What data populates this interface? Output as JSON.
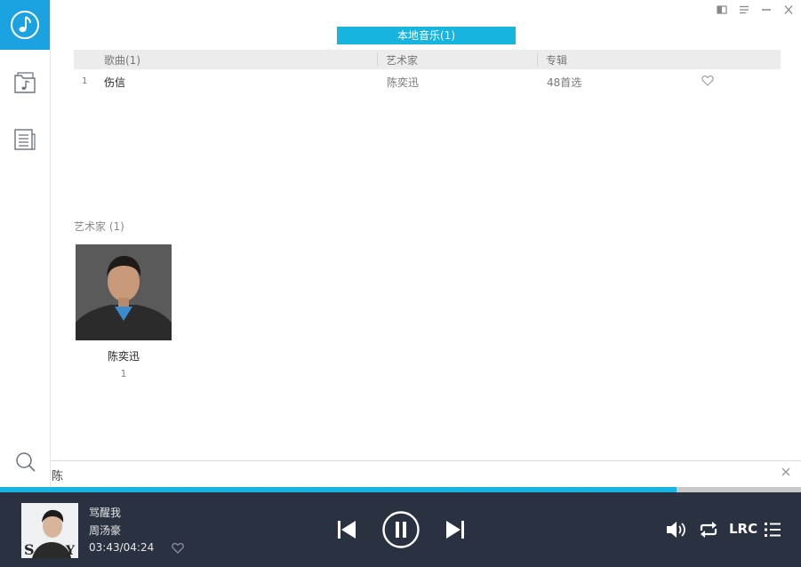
{
  "window": {
    "controls": [
      "mini-mode",
      "menu",
      "minimize",
      "close"
    ]
  },
  "tab": {
    "label": "本地音乐(1)"
  },
  "table": {
    "headers": {
      "song": "歌曲(1)",
      "artist": "艺术家",
      "album": "专辑"
    },
    "rows": [
      {
        "index": "1",
        "title": "伤信",
        "artist": "陈奕迅",
        "album": "48首选",
        "liked": false
      }
    ]
  },
  "artists": {
    "section_label": "艺术家  (1)",
    "items": [
      {
        "name": "陈奕迅",
        "count": "1"
      }
    ]
  },
  "search": {
    "value": "陈"
  },
  "player": {
    "title": "骂醒我",
    "artist": "周汤豪",
    "time": "03:43/04:24",
    "progress": 0.845,
    "lrc_label": "LRC",
    "state": "playing"
  },
  "colors": {
    "accent": "#17b4e0",
    "player_bg": "#2a3140",
    "logo_bg": "#1aa3e0"
  },
  "icons": [
    "music-note-icon",
    "folder-music-icon",
    "list-document-icon",
    "search-icon",
    "heart-icon",
    "previous-icon",
    "pause-icon",
    "next-icon",
    "volume-icon",
    "repeat-icon",
    "playlist-icon"
  ]
}
